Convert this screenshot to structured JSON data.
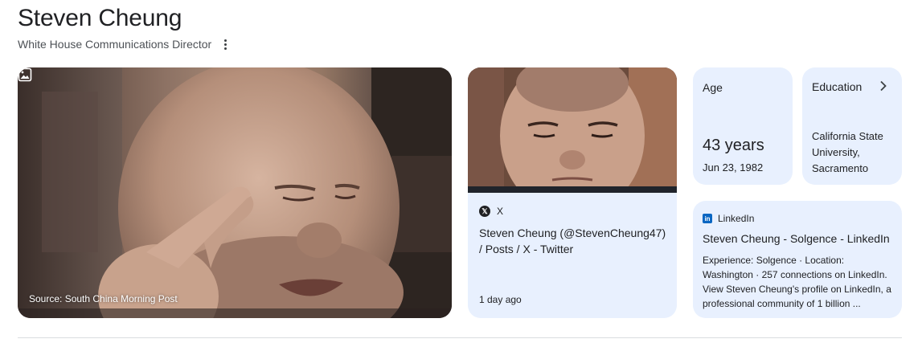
{
  "header": {
    "title": "Steven Cheung",
    "subtitle": "White House Communications Director",
    "more_icon": "more-vert-icon"
  },
  "main_image": {
    "source": "Source: South China Morning Post",
    "icon": "image-icon"
  },
  "x_card": {
    "source_name": "X",
    "title": "Steven Cheung (@StevenCheung47) / Posts / X - Twitter",
    "time": "1 day ago"
  },
  "age_card": {
    "label": "Age",
    "value": "43 years",
    "date": "Jun 23, 1982"
  },
  "education_card": {
    "label": "Education",
    "value": "California State University, Sacramento",
    "icon": "chevron-right-icon"
  },
  "linkedin_card": {
    "source_name": "LinkedIn",
    "title": "Steven Cheung - Solgence - LinkedIn",
    "snippet": "Experience: Solgence · Location: Washington · 257 connections on LinkedIn. View Steven Cheung's profile on LinkedIn, a professional community of 1 billion ..."
  },
  "colors": {
    "card_bg": "#e8f0fe",
    "linkedin_brand": "#0a66c2",
    "text": "#202124"
  }
}
